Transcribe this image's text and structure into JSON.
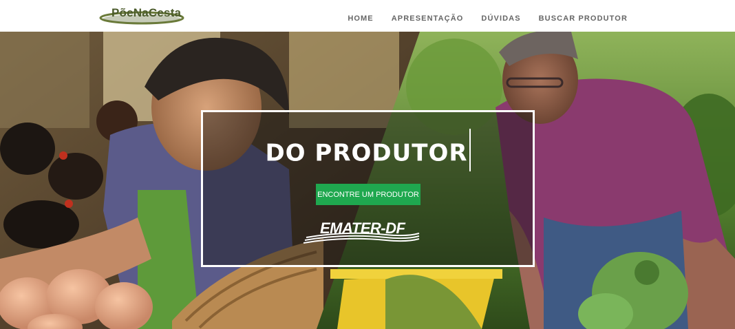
{
  "header": {
    "logo_text": "PõeNaCesta",
    "nav": [
      {
        "label": "HOME"
      },
      {
        "label": "APRESENTAÇÃO"
      },
      {
        "label": "DÚVIDAS"
      },
      {
        "label": "BUSCAR PRODUTOR"
      }
    ]
  },
  "hero": {
    "headline": "DO PRODUTOR",
    "cta_label": "ENCONTRE UM PRODUTOR",
    "partner_logo_text": "EMATER-DF"
  },
  "colors": {
    "cta_green": "#1fa84f",
    "logo_olive": "#4a5a2a",
    "nav_gray": "#666666"
  }
}
